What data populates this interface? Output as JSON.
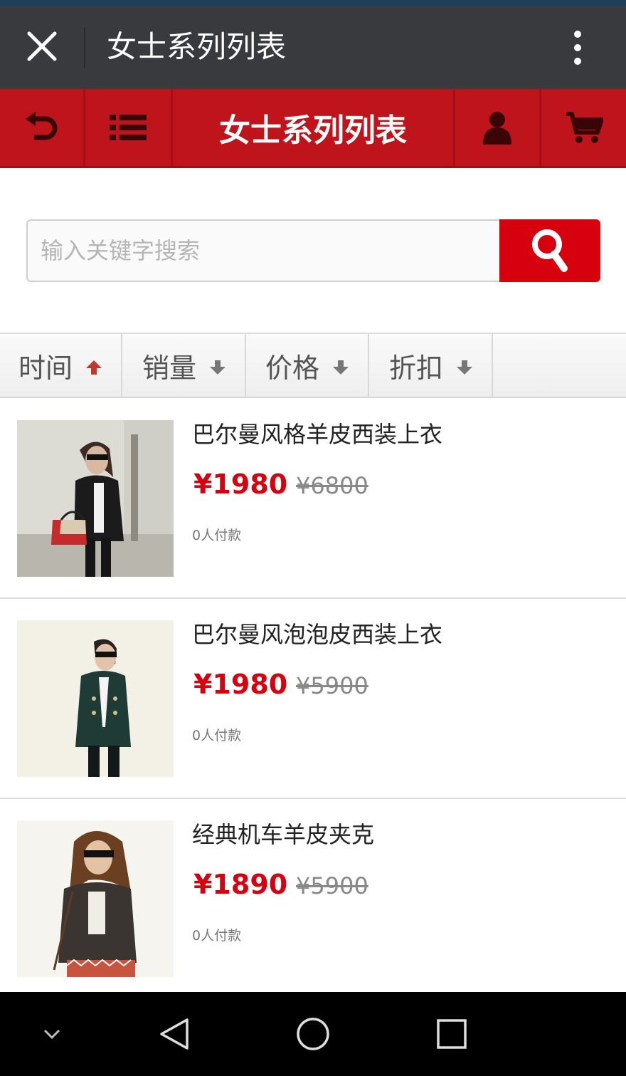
{
  "window": {
    "title": "女士系列列表"
  },
  "header": {
    "title": "女士系列列表"
  },
  "search": {
    "placeholder": "输入关键字搜索"
  },
  "sort_tabs": [
    {
      "label": "时间",
      "direction": "up",
      "active": true
    },
    {
      "label": "销量",
      "direction": "down",
      "active": false
    },
    {
      "label": "价格",
      "direction": "down",
      "active": false
    },
    {
      "label": "折扣",
      "direction": "down",
      "active": false
    }
  ],
  "products": [
    {
      "name": "巴尔曼风格羊皮西装上衣",
      "price": "¥1980",
      "original_price": "¥6800",
      "buyers": "0人付款"
    },
    {
      "name": "巴尔曼风泡泡皮西装上衣",
      "price": "¥1980",
      "original_price": "¥5900",
      "buyers": "0人付款"
    },
    {
      "name": "经典机车羊皮夹克",
      "price": "¥1890",
      "original_price": "¥5900",
      "buyers": "0人付款"
    }
  ],
  "colors": {
    "brand_red": "#c0141c",
    "search_red": "#d7000f",
    "titlebar": "#393a3e",
    "sort_up_arrow": "#c0392b",
    "sort_down_arrow": "#777777"
  },
  "icons": {
    "titlebar": [
      "close-icon",
      "more-vert-icon"
    ],
    "header": [
      "back-icon",
      "list-menu-icon",
      "user-icon",
      "cart-icon"
    ],
    "search": "search-icon",
    "navbar": [
      "chevron-down-icon",
      "back-triangle-icon",
      "home-circle-icon",
      "recents-square-icon"
    ]
  }
}
